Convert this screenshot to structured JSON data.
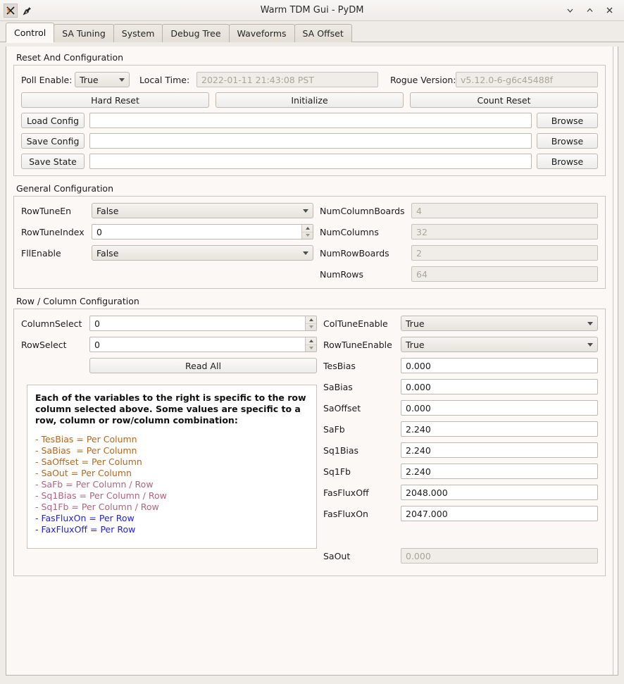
{
  "window": {
    "title": "Warm TDM Gui - PyDM",
    "app_icon": "x-logo-icon",
    "pin_icon": "pushpin-icon",
    "minimize_icon": "chevron-down-icon",
    "maximize_icon": "chevron-up-icon",
    "close_icon": "close-icon"
  },
  "tabs": [
    {
      "label": "Control",
      "active": true
    },
    {
      "label": "SA Tuning",
      "active": false
    },
    {
      "label": "System",
      "active": false
    },
    {
      "label": "Debug Tree",
      "active": false
    },
    {
      "label": "Waveforms",
      "active": false
    },
    {
      "label": "SA Offset",
      "active": false
    }
  ],
  "reset_config": {
    "group_title": "Reset And Configuration",
    "poll_enable_label": "Poll Enable:",
    "poll_enable_value": "True",
    "local_time_label": "Local Time:",
    "local_time_value": "2022-01-11 21:43:08 PST",
    "rogue_version_label": "Rogue Version:",
    "rogue_version_value": "v5.12.0-6-g6c45488f",
    "hard_reset_label": "Hard Reset",
    "initialize_label": "Initialize",
    "count_reset_label": "Count Reset",
    "load_config_label": "Load Config",
    "load_config_value": "",
    "save_config_label": "Save Config",
    "save_config_value": "",
    "save_state_label": "Save State",
    "save_state_value": "",
    "browse_label": "Browse"
  },
  "general_config": {
    "group_title": "General Configuration",
    "left": [
      {
        "label": "RowTuneEn",
        "value": "False",
        "widget": "combo"
      },
      {
        "label": "RowTuneIndex",
        "value": "0",
        "widget": "spin"
      },
      {
        "label": "FllEnable",
        "value": "False",
        "widget": "combo"
      }
    ],
    "right": [
      {
        "label": "NumColumnBoards",
        "value": "4",
        "widget": "readonly"
      },
      {
        "label": "NumColumns",
        "value": "32",
        "widget": "readonly"
      },
      {
        "label": "NumRowBoards",
        "value": "2",
        "widget": "readonly"
      },
      {
        "label": "NumRows",
        "value": "64",
        "widget": "readonly"
      }
    ]
  },
  "row_column_config": {
    "group_title": "Row / Column Configuration",
    "column_select_label": "ColumnSelect",
    "column_select_value": "0",
    "row_select_label": "RowSelect",
    "row_select_value": "0",
    "read_all_label": "Read All",
    "right": [
      {
        "label": "ColTuneEnable",
        "value": "True",
        "widget": "combo"
      },
      {
        "label": "RowTuneEnable",
        "value": "True",
        "widget": "combo"
      },
      {
        "label": "TesBias",
        "value": "0.000",
        "widget": "text"
      },
      {
        "label": "SaBias",
        "value": "0.000",
        "widget": "text"
      },
      {
        "label": "SaOffset",
        "value": "0.000",
        "widget": "text"
      },
      {
        "label": "SaFb",
        "value": "2.240",
        "widget": "text"
      },
      {
        "label": "Sq1Bias",
        "value": "2.240",
        "widget": "text"
      },
      {
        "label": "Sq1Fb",
        "value": "2.240",
        "widget": "text"
      },
      {
        "label": "FasFluxOff",
        "value": "2048.000",
        "widget": "text"
      },
      {
        "label": "FasFluxOn",
        "value": "2047.000",
        "widget": "text"
      },
      {
        "label": "",
        "value": "",
        "widget": "spacer"
      },
      {
        "label": "SaOut",
        "value": "0.000",
        "widget": "readonly"
      }
    ],
    "info_box": {
      "heading": "Each of the variables to the right is specific to the row column selected above. Some values are specific to a row, column or row/column combination:",
      "lines": [
        {
          "text": "- TesBias = Per Column",
          "color": "#b5651d"
        },
        {
          "text": "- SaBias  = Per Column",
          "color": "#b5651d"
        },
        {
          "text": "- SaOffset = Per Column",
          "color": "#b5651d"
        },
        {
          "text": "- SaOut = Per Column",
          "color": "#b5651d"
        },
        {
          "text": "- SaFb = Per Column / Row",
          "color": "#b5607f"
        },
        {
          "text": "- Sq1Bias = Per Column / Row",
          "color": "#b5607f"
        },
        {
          "text": "- Sq1Fb = Per Column / Row",
          "color": "#b5607f"
        },
        {
          "text": "- FasFluxOn = Per Row",
          "color": "#2222dd"
        },
        {
          "text": "- FaxFluxOff = Per Row",
          "color": "#2222dd"
        }
      ]
    }
  }
}
